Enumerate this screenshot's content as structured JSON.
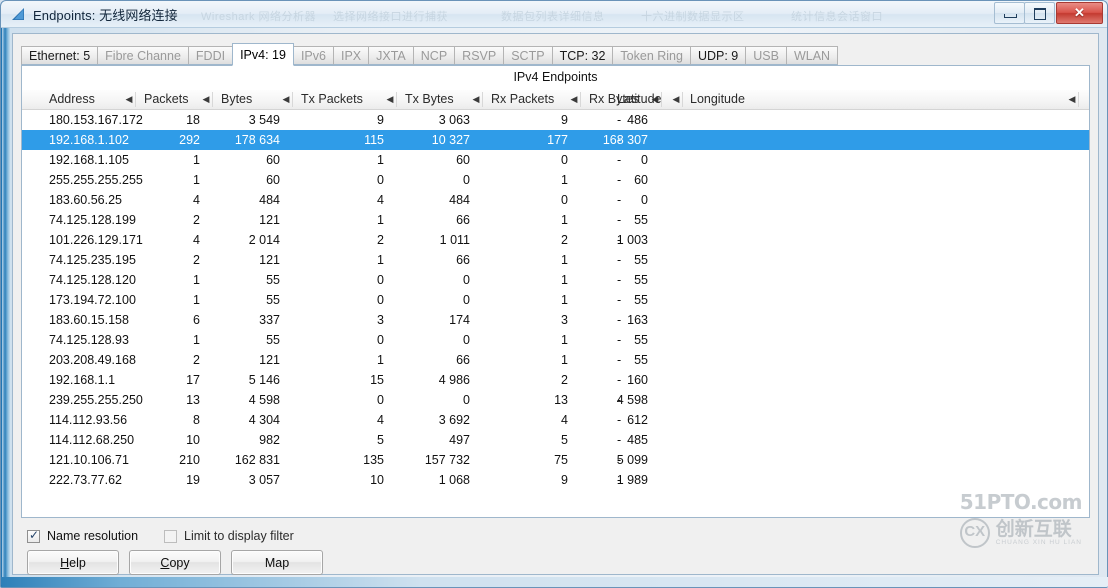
{
  "window": {
    "title": "Endpoints: 无线网络连接",
    "icon": "wireshark-fin-icon",
    "ghost_texts": [
      "Wireshark 网络分析器",
      "选择网络接口进行捕获",
      "数据包列表详细信息",
      "十六进制数据显示区",
      "统计信息会话窗口"
    ],
    "caption": {
      "minimize_label": "Minimize",
      "maximize_label": "Restore",
      "close_label": "✕"
    }
  },
  "tabs": [
    {
      "label": "Ethernet: 5",
      "state": "enabled"
    },
    {
      "label": "Fibre Channe",
      "state": "disabled"
    },
    {
      "label": "FDDI",
      "state": "disabled"
    },
    {
      "label": "IPv4: 19",
      "state": "active"
    },
    {
      "label": "IPv6",
      "state": "disabled"
    },
    {
      "label": "IPX",
      "state": "disabled"
    },
    {
      "label": "JXTA",
      "state": "disabled"
    },
    {
      "label": "NCP",
      "state": "disabled"
    },
    {
      "label": "RSVP",
      "state": "disabled"
    },
    {
      "label": "SCTP",
      "state": "disabled"
    },
    {
      "label": "TCP: 32",
      "state": "enabled"
    },
    {
      "label": "Token Ring",
      "state": "disabled"
    },
    {
      "label": "UDP: 9",
      "state": "enabled"
    },
    {
      "label": "USB",
      "state": "disabled"
    },
    {
      "label": "WLAN",
      "state": "disabled"
    }
  ],
  "table": {
    "caption": "IPv4 Endpoints",
    "sort_glyph": "◀",
    "columns": [
      "Address",
      "Packets",
      "Bytes",
      "Tx Packets",
      "Tx Bytes",
      "Rx Packets",
      "Rx Bytes",
      "Latitude",
      "Longitude"
    ],
    "selected_row_index": 1,
    "selection_color": "#2f9ce8",
    "rows": [
      {
        "address": "180.153.167.172",
        "packets": "18",
        "bytes": "3 549",
        "tx_packets": "9",
        "tx_bytes": "3 063",
        "rx_packets": "9",
        "rx_bytes": "486",
        "latitude": "-",
        "longitude": "-"
      },
      {
        "address": "192.168.1.102",
        "packets": "292",
        "bytes": "178 634",
        "tx_packets": "115",
        "tx_bytes": "10 327",
        "rx_packets": "177",
        "rx_bytes": "168 307",
        "latitude": "-",
        "longitude": "-"
      },
      {
        "address": "192.168.1.105",
        "packets": "1",
        "bytes": "60",
        "tx_packets": "1",
        "tx_bytes": "60",
        "rx_packets": "0",
        "rx_bytes": "0",
        "latitude": "-",
        "longitude": "-"
      },
      {
        "address": "255.255.255.255",
        "packets": "1",
        "bytes": "60",
        "tx_packets": "0",
        "tx_bytes": "0",
        "rx_packets": "1",
        "rx_bytes": "60",
        "latitude": "-",
        "longitude": "-"
      },
      {
        "address": "183.60.56.25",
        "packets": "4",
        "bytes": "484",
        "tx_packets": "4",
        "tx_bytes": "484",
        "rx_packets": "0",
        "rx_bytes": "0",
        "latitude": "-",
        "longitude": "-"
      },
      {
        "address": "74.125.128.199",
        "packets": "2",
        "bytes": "121",
        "tx_packets": "1",
        "tx_bytes": "66",
        "rx_packets": "1",
        "rx_bytes": "55",
        "latitude": "-",
        "longitude": "-"
      },
      {
        "address": "101.226.129.171",
        "packets": "4",
        "bytes": "2 014",
        "tx_packets": "2",
        "tx_bytes": "1 011",
        "rx_packets": "2",
        "rx_bytes": "1 003",
        "latitude": "-",
        "longitude": "-"
      },
      {
        "address": "74.125.235.195",
        "packets": "2",
        "bytes": "121",
        "tx_packets": "1",
        "tx_bytes": "66",
        "rx_packets": "1",
        "rx_bytes": "55",
        "latitude": "-",
        "longitude": "-"
      },
      {
        "address": "74.125.128.120",
        "packets": "1",
        "bytes": "55",
        "tx_packets": "0",
        "tx_bytes": "0",
        "rx_packets": "1",
        "rx_bytes": "55",
        "latitude": "-",
        "longitude": "-"
      },
      {
        "address": "173.194.72.100",
        "packets": "1",
        "bytes": "55",
        "tx_packets": "0",
        "tx_bytes": "0",
        "rx_packets": "1",
        "rx_bytes": "55",
        "latitude": "-",
        "longitude": "-"
      },
      {
        "address": "183.60.15.158",
        "packets": "6",
        "bytes": "337",
        "tx_packets": "3",
        "tx_bytes": "174",
        "rx_packets": "3",
        "rx_bytes": "163",
        "latitude": "-",
        "longitude": "-"
      },
      {
        "address": "74.125.128.93",
        "packets": "1",
        "bytes": "55",
        "tx_packets": "0",
        "tx_bytes": "0",
        "rx_packets": "1",
        "rx_bytes": "55",
        "latitude": "-",
        "longitude": "-"
      },
      {
        "address": "203.208.49.168",
        "packets": "2",
        "bytes": "121",
        "tx_packets": "1",
        "tx_bytes": "66",
        "rx_packets": "1",
        "rx_bytes": "55",
        "latitude": "-",
        "longitude": "-"
      },
      {
        "address": "192.168.1.1",
        "packets": "17",
        "bytes": "5 146",
        "tx_packets": "15",
        "tx_bytes": "4 986",
        "rx_packets": "2",
        "rx_bytes": "160",
        "latitude": "-",
        "longitude": "-"
      },
      {
        "address": "239.255.255.250",
        "packets": "13",
        "bytes": "4 598",
        "tx_packets": "0",
        "tx_bytes": "0",
        "rx_packets": "13",
        "rx_bytes": "4 598",
        "latitude": "-",
        "longitude": "-"
      },
      {
        "address": "114.112.93.56",
        "packets": "8",
        "bytes": "4 304",
        "tx_packets": "4",
        "tx_bytes": "3 692",
        "rx_packets": "4",
        "rx_bytes": "612",
        "latitude": "-",
        "longitude": "-"
      },
      {
        "address": "114.112.68.250",
        "packets": "10",
        "bytes": "982",
        "tx_packets": "5",
        "tx_bytes": "497",
        "rx_packets": "5",
        "rx_bytes": "485",
        "latitude": "-",
        "longitude": "-"
      },
      {
        "address": "121.10.106.71",
        "packets": "210",
        "bytes": "162 831",
        "tx_packets": "135",
        "tx_bytes": "157 732",
        "rx_packets": "75",
        "rx_bytes": "5 099",
        "latitude": "-",
        "longitude": "-"
      },
      {
        "address": "222.73.77.62",
        "packets": "19",
        "bytes": "3 057",
        "tx_packets": "10",
        "tx_bytes": "1 068",
        "rx_packets": "9",
        "rx_bytes": "1 989",
        "latitude": "-",
        "longitude": "-"
      }
    ]
  },
  "options": {
    "name_resolution": {
      "label": "Name resolution",
      "checked": true,
      "tick": "✓"
    },
    "limit_to_display_filter": {
      "label": "Limit to display filter",
      "checked": false,
      "tick": ""
    }
  },
  "buttons": [
    {
      "id": "help",
      "mnemonic": "H",
      "rest": "elp",
      "pre": ""
    },
    {
      "id": "copy",
      "mnemonic": "C",
      "rest": "opy",
      "pre": ""
    },
    {
      "id": "map",
      "mnemonic": "",
      "rest": "",
      "pre": "Map"
    }
  ],
  "watermark": {
    "top": "51PTO.com",
    "mark": "CX",
    "cn": "创新互联",
    "pinyin": "CHUANG XIN HU LIAN"
  }
}
